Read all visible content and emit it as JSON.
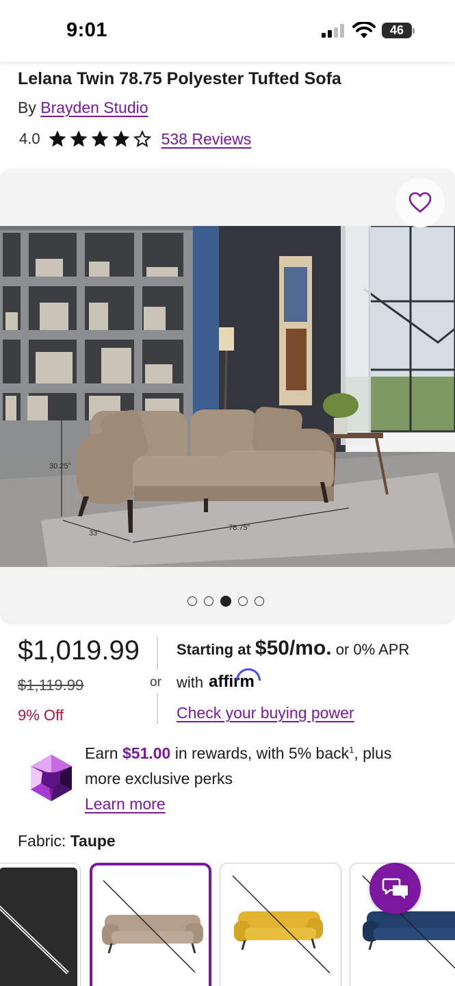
{
  "status_bar": {
    "time": "9:01",
    "battery": "46"
  },
  "product": {
    "title": "Lelana Twin 78.75 Polyester Tufted Sofa",
    "by_prefix": "By ",
    "brand": "Brayden Studio",
    "rating": "4.0",
    "stars_filled": 4,
    "stars_total": 5,
    "reviews": "538 Reviews"
  },
  "gallery": {
    "photo_dimensions": {
      "height": "30.25\"",
      "depth": "33\"",
      "width": "78.75\""
    },
    "current_slide": 3,
    "slide_count": 5
  },
  "pricing": {
    "price": "$1,019.99",
    "was_price": "$1,119.99",
    "discount": "9% Off",
    "or": "or",
    "financing_prefix": "Starting at ",
    "financing_amount": "$50/mo.",
    "financing_suffix": " or 0% APR",
    "with_label": "with",
    "affirm": "affirm",
    "buying_power_link": "Check your buying power"
  },
  "rewards": {
    "earn": "Earn ",
    "amount": "$51.00",
    "line1_rest": " in rewards, with 5% back",
    "footnote": "1",
    "line1_end": ", plus",
    "line2": "more exclusive perks",
    "learn_more": "Learn more"
  },
  "fabric": {
    "label": "Fabric: ",
    "selected": "Taupe",
    "swatches": [
      "Charcoal",
      "Taupe",
      "Yellow",
      "Navy"
    ]
  },
  "colors": {
    "brand_purple": "#7b189f",
    "discount_red": "#b4123e",
    "swatch_taupe": "#b39e8b",
    "swatch_yellow": "#e2b431",
    "swatch_navy": "#22406b"
  }
}
